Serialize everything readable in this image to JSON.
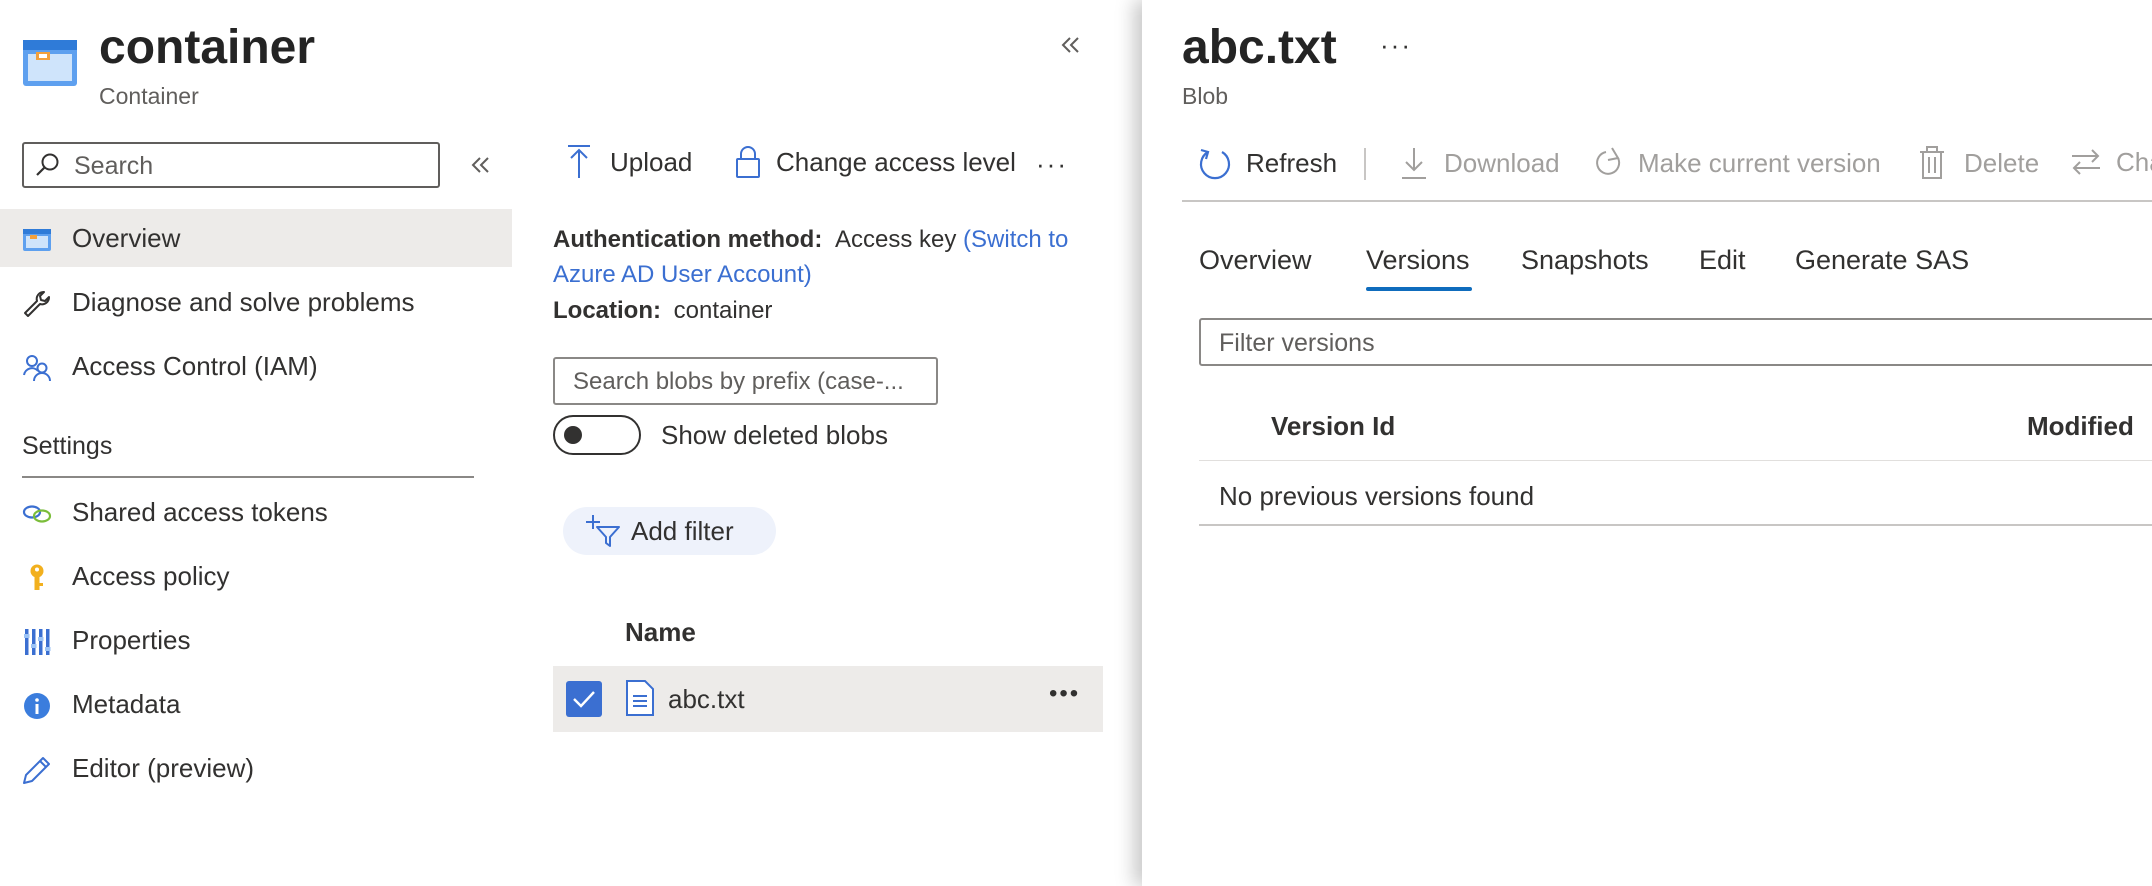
{
  "container_header": {
    "title": "container",
    "subtitle": "Container",
    "collapse_icon": "double-chevron-left-icon"
  },
  "sidebar": {
    "search_placeholder": "Search",
    "collapse_icon": "double-chevron-left-icon",
    "items": [
      {
        "label": "Overview",
        "icon": "container-icon",
        "selected": true
      },
      {
        "label": "Diagnose and solve problems",
        "icon": "wrench-icon"
      },
      {
        "label": "Access Control (IAM)",
        "icon": "people-icon"
      }
    ],
    "settings_heading": "Settings",
    "settings_items": [
      {
        "label": "Shared access tokens",
        "icon": "chain-link-icon"
      },
      {
        "label": "Access policy",
        "icon": "key-icon"
      },
      {
        "label": "Properties",
        "icon": "properties-bars-icon"
      },
      {
        "label": "Metadata",
        "icon": "info-icon"
      },
      {
        "label": "Editor (preview)",
        "icon": "pencil-icon"
      }
    ]
  },
  "container_toolbar": {
    "upload_label": "Upload",
    "change_access_label": "Change access level",
    "more_label": "···"
  },
  "container_info": {
    "auth_label": "Authentication method:",
    "auth_value": "Access key",
    "auth_link_line1": "(Switch to",
    "auth_link_line2": "Azure AD User Account)",
    "location_label": "Location:",
    "location_value": "container"
  },
  "blob_search": {
    "placeholder": "Search blobs by prefix (case-..."
  },
  "show_deleted": {
    "label": "Show deleted blobs",
    "on": false
  },
  "add_filter": {
    "label": "Add filter"
  },
  "blob_list": {
    "column_name": "Name",
    "rows": [
      {
        "name": "abc.txt",
        "checked": true,
        "more": "•••"
      }
    ]
  },
  "blob_panel": {
    "title": "abc.txt",
    "more": "···",
    "subtitle": "Blob",
    "toolbar": {
      "refresh": "Refresh",
      "download": "Download",
      "make_current": "Make current version",
      "delete": "Delete",
      "change_tier": "Cha"
    },
    "tabs": [
      "Overview",
      "Versions",
      "Snapshots",
      "Edit",
      "Generate SAS"
    ],
    "active_tab": "Versions",
    "filter_placeholder": "Filter versions",
    "table": {
      "col_version_id": "Version Id",
      "col_modified": "Modified",
      "empty_message": "No previous versions found"
    }
  },
  "colors": {
    "accent": "#0f6cbd",
    "link": "#3b6fd1",
    "selected_bg": "#edebe9",
    "checkbox": "#3b6fd1",
    "pill_bg": "#eef2fb"
  }
}
